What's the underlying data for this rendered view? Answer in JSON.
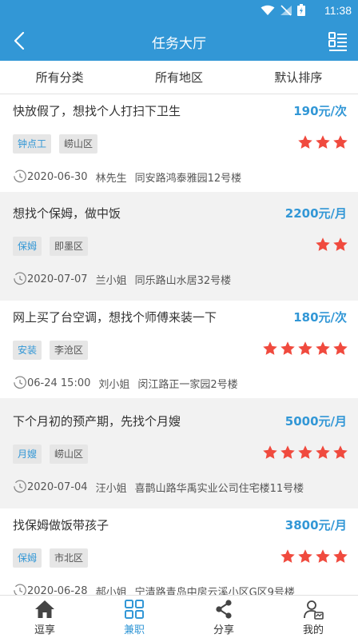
{
  "status_bar": {
    "time": "11:38"
  },
  "header": {
    "title": "任务大厅"
  },
  "filters": [
    "所有分类",
    "所有地区",
    "默认排序"
  ],
  "tasks": [
    {
      "title": "快放假了，想找个人打扫下卫生",
      "price": "190元/次",
      "category": "钟点工",
      "district": "崂山区",
      "stars": 3,
      "date": "2020-06-30",
      "contact": "林先生",
      "address": "同安路鸿泰雅园12号楼"
    },
    {
      "title": "想找个保姆，做中饭",
      "price": "2200元/月",
      "category": "保姆",
      "district": "即墨区",
      "stars": 2,
      "date": "2020-07-07",
      "contact": "兰小姐",
      "address": "同乐路山水居32号楼"
    },
    {
      "title": "网上买了台空调，想找个师傅来装一下",
      "price": "180元/次",
      "category": "安装",
      "district": "李沧区",
      "stars": 5,
      "date": "06-24 15:00",
      "contact": "刘小姐",
      "address": "闵江路正一家园2号楼"
    },
    {
      "title": "下个月初的预产期，先找个月嫂",
      "price": "5000元/月",
      "category": "月嫂",
      "district": "崂山区",
      "stars": 5,
      "date": "2020-07-04",
      "contact": "汪小姐",
      "address": "喜鹊山路华禹实业公司住宅楼11号楼"
    },
    {
      "title": "找保姆做饭带孩子",
      "price": "3800元/月",
      "category": "保姆",
      "district": "市北区",
      "stars": 4,
      "date": "2020-06-28",
      "contact": "郝小姐",
      "address": "宁清路青岛中房云溪小区G区9号楼"
    }
  ],
  "tabs": [
    {
      "label": "逗享",
      "icon": "home-icon"
    },
    {
      "label": "兼职",
      "icon": "grid-icon"
    },
    {
      "label": "分享",
      "icon": "share-icon"
    },
    {
      "label": "我的",
      "icon": "profile-icon"
    }
  ],
  "active_tab": "兼职",
  "colors": {
    "primary": "#3297d6",
    "star": "#f04a3e",
    "tag_bg": "#e6e6e6"
  }
}
